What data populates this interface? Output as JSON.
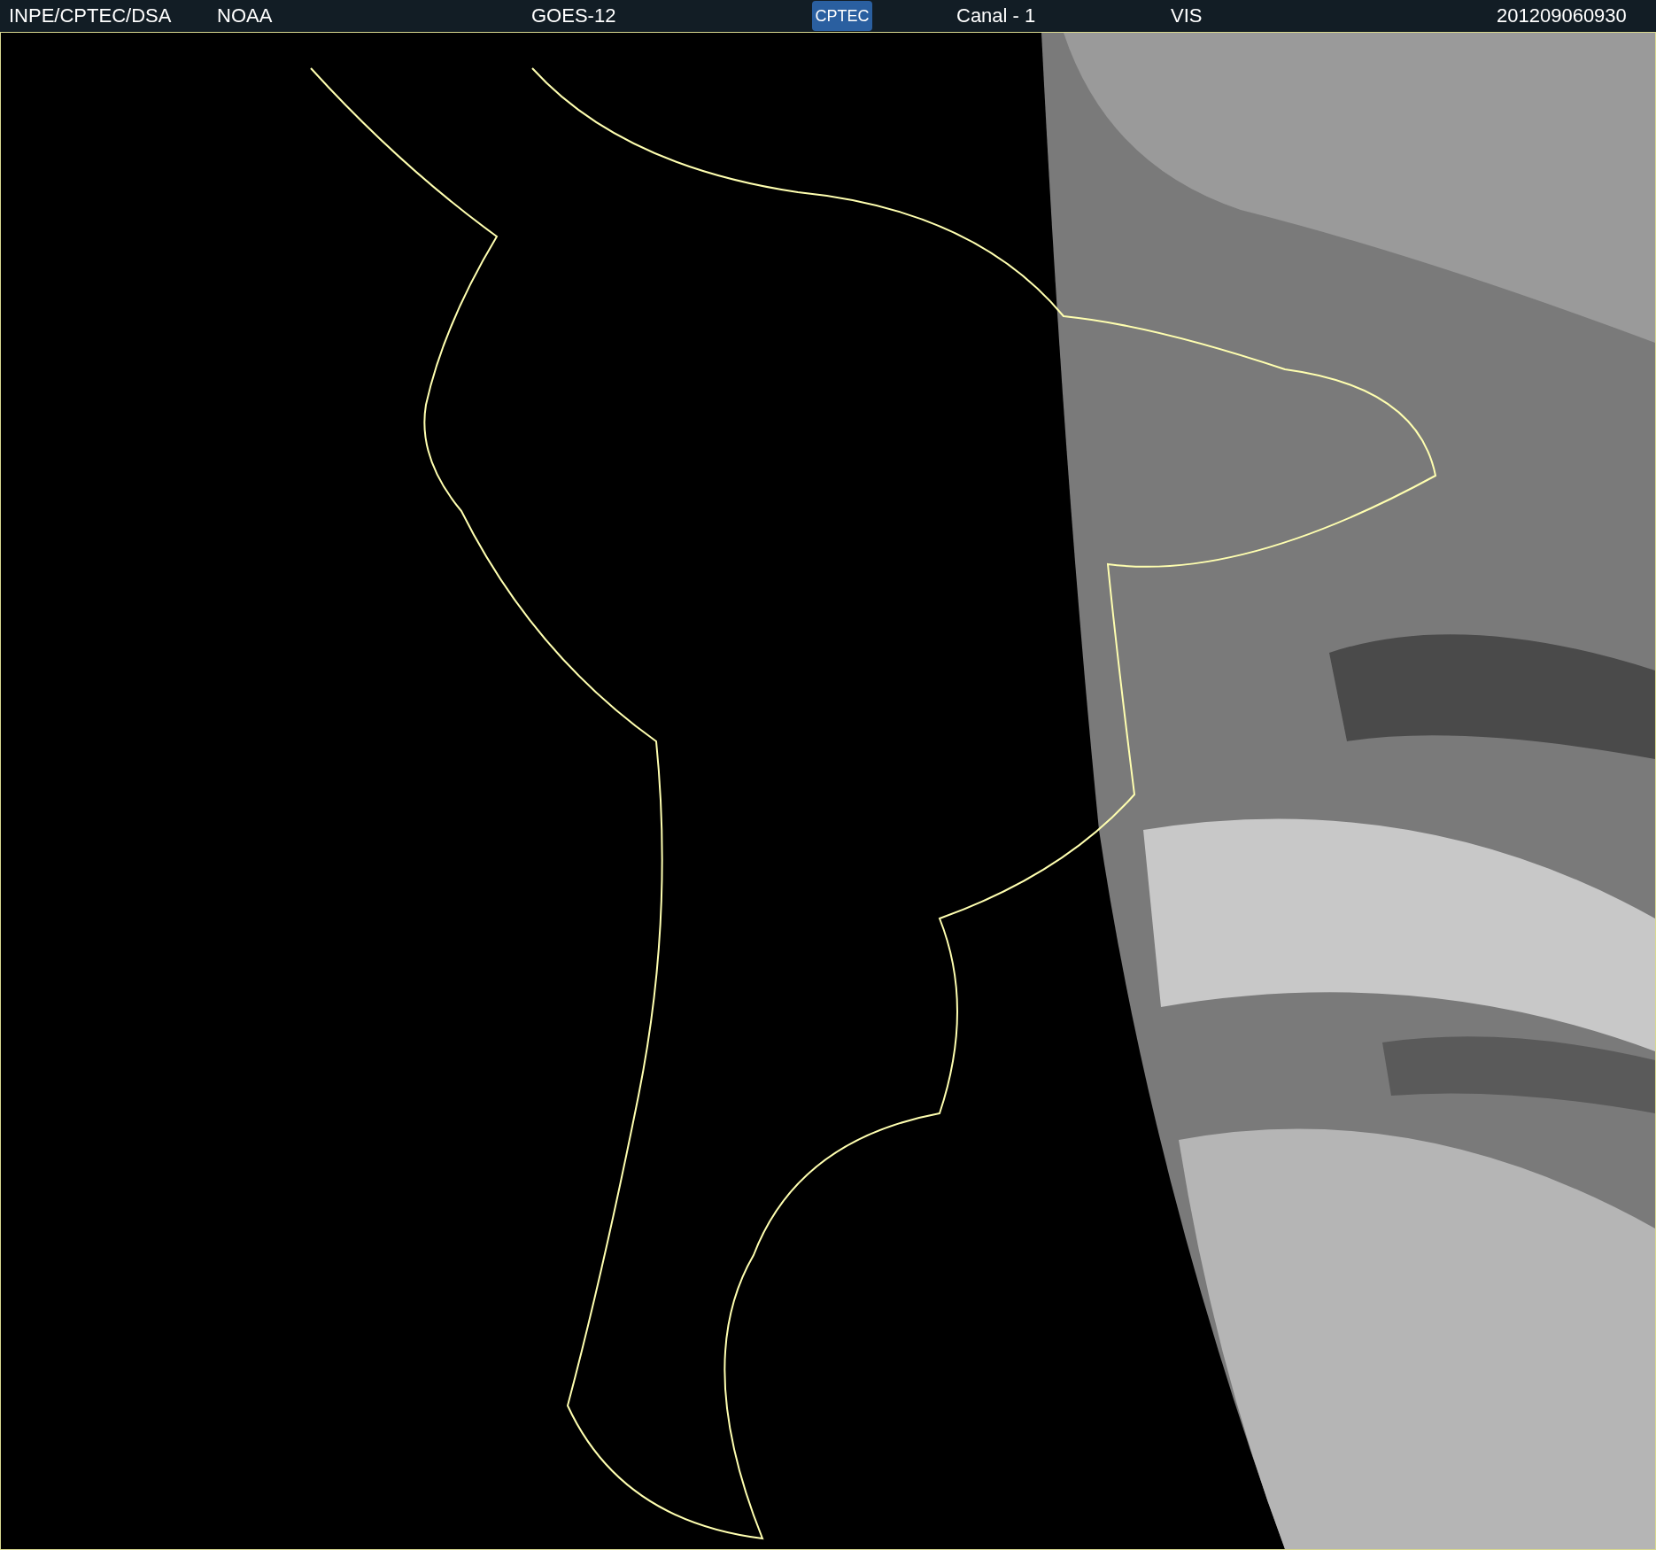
{
  "header": {
    "items": [
      {
        "kind": "text",
        "text": "INPE/CPTEC/DSA"
      },
      {
        "kind": "text",
        "text": "NOAA"
      },
      {
        "kind": "text",
        "text": "GOES-12"
      },
      {
        "kind": "logo",
        "text": "CPTEC"
      },
      {
        "kind": "text",
        "text": "Canal - 1"
      },
      {
        "kind": "text",
        "text": "VIS"
      },
      {
        "kind": "text",
        "text": "201209060930"
      }
    ]
  }
}
